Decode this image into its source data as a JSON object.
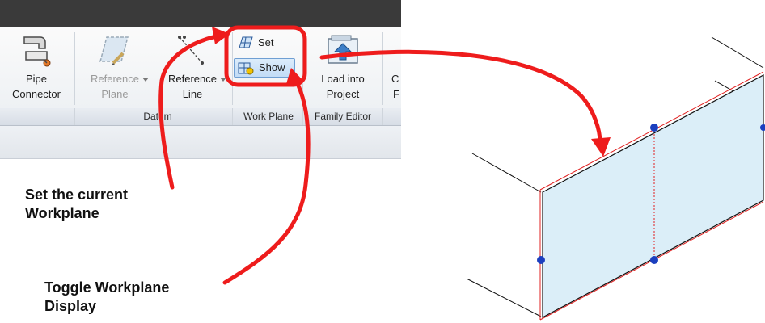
{
  "ribbon": {
    "buttons": {
      "pipe_connector": [
        "Pipe",
        "Connector"
      ],
      "reference_plane": [
        "Reference",
        "Plane"
      ],
      "reference_line": [
        "Reference",
        "Line"
      ],
      "load_into_project": [
        "Load into",
        "Project"
      ],
      "cut_off": [
        "C",
        "F"
      ]
    },
    "work_plane": {
      "set_label": "Set",
      "show_label": "Show"
    },
    "panels": {
      "datum": "Datum",
      "work_plane": "Work Plane",
      "family_editor": "Family Editor"
    }
  },
  "annotations": {
    "set_workplane": [
      "Set the current",
      "Workplane"
    ],
    "toggle_display": [
      "Toggle Workplane",
      "Display"
    ]
  },
  "colors": {
    "arrow": "#ee1c1c",
    "plane_fill": "#dbeef8",
    "grip": "#1b3fbf",
    "highlight": "#4a90d9"
  }
}
